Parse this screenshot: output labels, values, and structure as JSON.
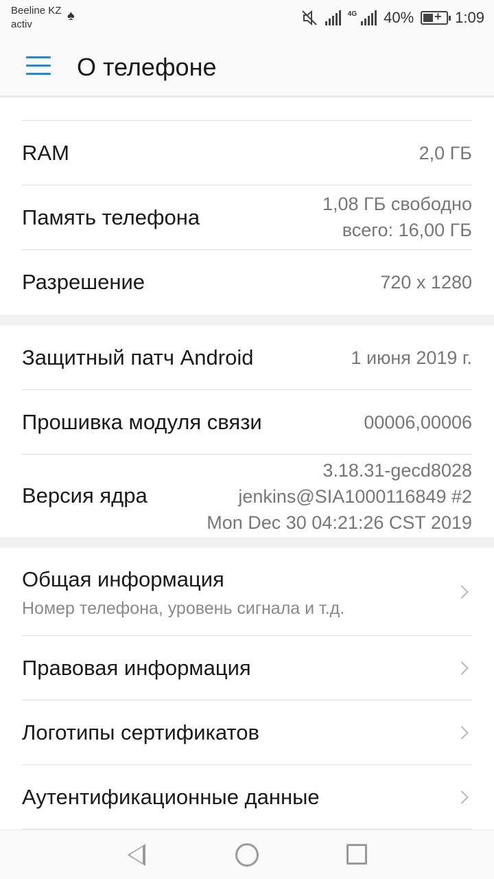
{
  "status_bar": {
    "carrier_line1": "Beeline KZ",
    "carrier_line2": "activ",
    "network": "4G",
    "battery_percent": "40%",
    "time": "1:09"
  },
  "app_bar": {
    "title": "О телефоне"
  },
  "info_rows": [
    {
      "label": "RAM",
      "value": "2,0  ГБ"
    },
    {
      "label": "Память телефона",
      "value_line1": "1,08  ГБ свободно",
      "value_line2": "всего: 16,00  ГБ"
    },
    {
      "label": "Разрешение",
      "value": "720 x 1280"
    }
  ],
  "software_rows": [
    {
      "label": "Защитный патч Android",
      "value": "1 июня 2019 г."
    },
    {
      "label": "Прошивка модуля связи",
      "value": "00006,00006"
    },
    {
      "label": "Версия ядра",
      "value_line1": "3.18.31-gecd8028",
      "value_line2": "jenkins@SIA1000116849 #2",
      "value_line3": "Mon Dec 30 04:21:26 CST 2019"
    }
  ],
  "nav_rows": [
    {
      "label": "Общая информация",
      "subtitle": "Номер телефона, уровень сигнала и т.д."
    },
    {
      "label": "Правовая информация"
    },
    {
      "label": "Логотипы сертификатов"
    },
    {
      "label": "Аутентификационные данные"
    }
  ],
  "colors": {
    "accent": "#1e88e5",
    "secondary_text": "#777777",
    "divider": "#e0e0e0",
    "section_gap": "#f1f1f1"
  }
}
